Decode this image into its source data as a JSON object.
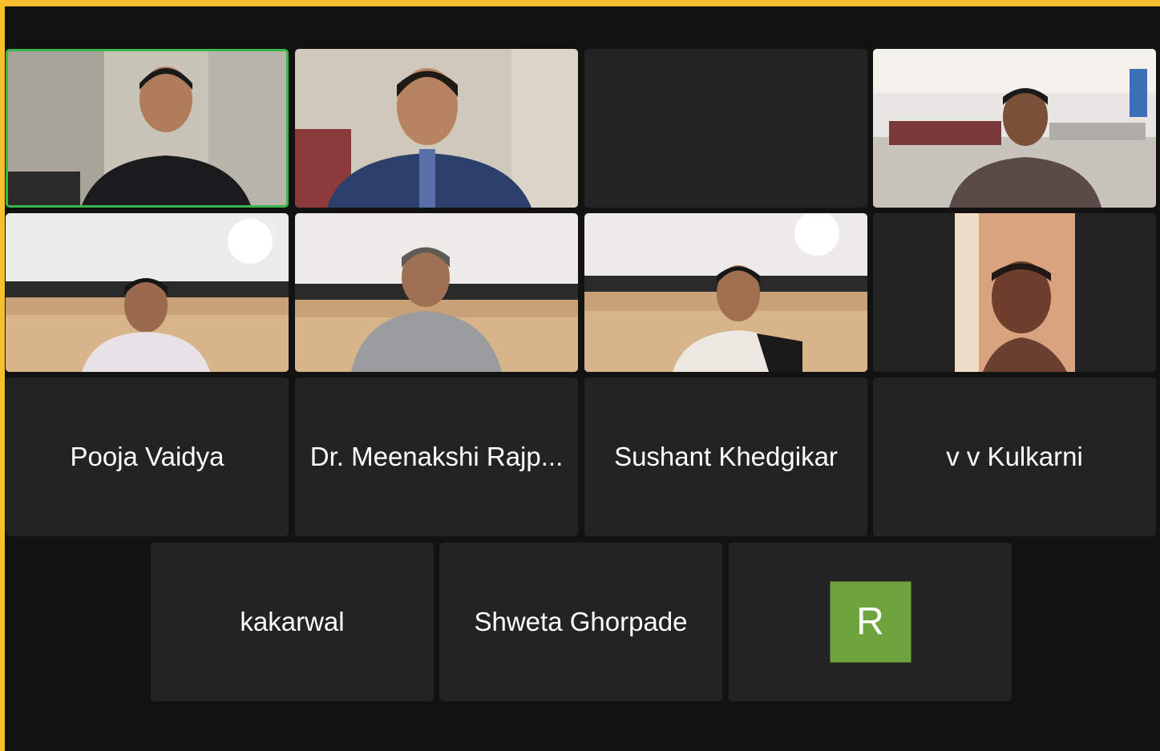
{
  "meeting": {
    "accent_color": "#f7bf2e",
    "active_speaker_color": "#3ab54a",
    "video_tiles": [
      {
        "participant": "active speaker, indoor office",
        "icon": "video-feed-icon"
      },
      {
        "participant": "participant in checked shirt",
        "icon": "video-feed-icon"
      },
      {
        "participant": "empty dark tile",
        "icon": "video-off-icon"
      },
      {
        "participant": "participant in computer lab",
        "icon": "video-feed-icon"
      },
      {
        "participant": "participant in lab, white dupatta",
        "icon": "video-feed-icon"
      },
      {
        "participant": "participant in lab, grey shirt",
        "icon": "video-feed-icon"
      },
      {
        "participant": "participant in lab, striped top",
        "icon": "video-feed-icon"
      },
      {
        "participant": "participant portrait video",
        "icon": "video-feed-icon"
      }
    ],
    "name_tiles": [
      {
        "label": "Pooja Vaidya"
      },
      {
        "label": "Dr. Meenakshi Rajp..."
      },
      {
        "label": "Sushant Khedgikar"
      },
      {
        "label": "v v Kulkarni"
      },
      {
        "label": "kakarwal"
      },
      {
        "label": "Shweta Ghorpade"
      }
    ],
    "avatar_tile": {
      "initial": "R",
      "color": "#6fa33d"
    }
  }
}
